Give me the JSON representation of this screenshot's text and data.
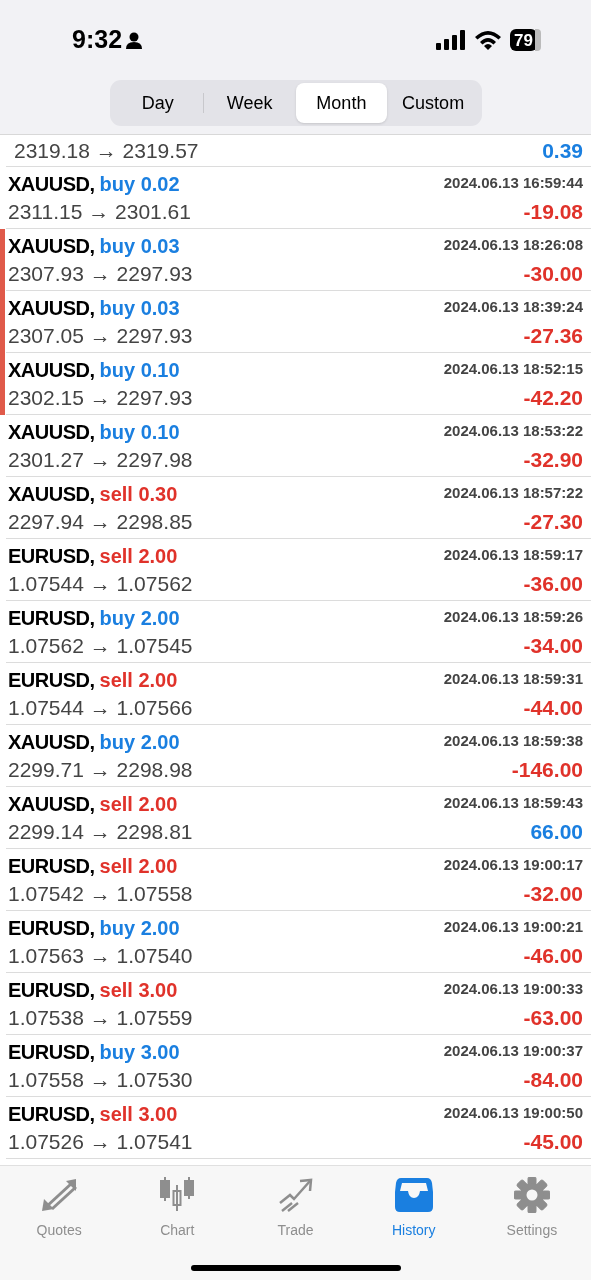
{
  "status_bar": {
    "time": "9:32",
    "battery": "79"
  },
  "segments": [
    {
      "label": "Day",
      "selected": false
    },
    {
      "label": "Week",
      "selected": false
    },
    {
      "label": "Month",
      "selected": true
    },
    {
      "label": "Custom",
      "selected": false
    }
  ],
  "partial_row": {
    "prices": "2319.18 → 2319.57",
    "profit": "0.39",
    "gain": true
  },
  "trades": [
    {
      "symbol": "XAUUSD,",
      "side": "buy",
      "volume": "0.02",
      "time": "2024.06.13 16:59:44",
      "prices": "2311.15 → 2301.61",
      "profit": "-19.08",
      "gain": false,
      "flagged": false
    },
    {
      "symbol": "XAUUSD,",
      "side": "buy",
      "volume": "0.03",
      "time": "2024.06.13 18:26:08",
      "prices": "2307.93 → 2297.93",
      "profit": "-30.00",
      "gain": false,
      "flagged": true
    },
    {
      "symbol": "XAUUSD,",
      "side": "buy",
      "volume": "0.03",
      "time": "2024.06.13 18:39:24",
      "prices": "2307.05 → 2297.93",
      "profit": "-27.36",
      "gain": false,
      "flagged": true
    },
    {
      "symbol": "XAUUSD,",
      "side": "buy",
      "volume": "0.10",
      "time": "2024.06.13 18:52:15",
      "prices": "2302.15 → 2297.93",
      "profit": "-42.20",
      "gain": false,
      "flagged": true
    },
    {
      "symbol": "XAUUSD,",
      "side": "buy",
      "volume": "0.10",
      "time": "2024.06.13 18:53:22",
      "prices": "2301.27 → 2297.98",
      "profit": "-32.90",
      "gain": false,
      "flagged": false
    },
    {
      "symbol": "XAUUSD,",
      "side": "sell",
      "volume": "0.30",
      "time": "2024.06.13 18:57:22",
      "prices": "2297.94 → 2298.85",
      "profit": "-27.30",
      "gain": false,
      "flagged": false
    },
    {
      "symbol": "EURUSD,",
      "side": "sell",
      "volume": "2.00",
      "time": "2024.06.13 18:59:17",
      "prices": "1.07544 → 1.07562",
      "profit": "-36.00",
      "gain": false,
      "flagged": false
    },
    {
      "symbol": "EURUSD,",
      "side": "buy",
      "volume": "2.00",
      "time": "2024.06.13 18:59:26",
      "prices": "1.07562 → 1.07545",
      "profit": "-34.00",
      "gain": false,
      "flagged": false
    },
    {
      "symbol": "EURUSD,",
      "side": "sell",
      "volume": "2.00",
      "time": "2024.06.13 18:59:31",
      "prices": "1.07544 → 1.07566",
      "profit": "-44.00",
      "gain": false,
      "flagged": false
    },
    {
      "symbol": "XAUUSD,",
      "side": "buy",
      "volume": "2.00",
      "time": "2024.06.13 18:59:38",
      "prices": "2299.71 → 2298.98",
      "profit": "-146.00",
      "gain": false,
      "flagged": false
    },
    {
      "symbol": "XAUUSD,",
      "side": "sell",
      "volume": "2.00",
      "time": "2024.06.13 18:59:43",
      "prices": "2299.14 → 2298.81",
      "profit": "66.00",
      "gain": true,
      "flagged": false
    },
    {
      "symbol": "EURUSD,",
      "side": "sell",
      "volume": "2.00",
      "time": "2024.06.13 19:00:17",
      "prices": "1.07542 → 1.07558",
      "profit": "-32.00",
      "gain": false,
      "flagged": false
    },
    {
      "symbol": "EURUSD,",
      "side": "buy",
      "volume": "2.00",
      "time": "2024.06.13 19:00:21",
      "prices": "1.07563 → 1.07540",
      "profit": "-46.00",
      "gain": false,
      "flagged": false
    },
    {
      "symbol": "EURUSD,",
      "side": "sell",
      "volume": "3.00",
      "time": "2024.06.13 19:00:33",
      "prices": "1.07538 → 1.07559",
      "profit": "-63.00",
      "gain": false,
      "flagged": false
    },
    {
      "symbol": "EURUSD,",
      "side": "buy",
      "volume": "3.00",
      "time": "2024.06.13 19:00:37",
      "prices": "1.07558 → 1.07530",
      "profit": "-84.00",
      "gain": false,
      "flagged": false
    },
    {
      "symbol": "EURUSD,",
      "side": "sell",
      "volume": "3.00",
      "time": "2024.06.13 19:00:50",
      "prices": "1.07526 → 1.07541",
      "profit": "-45.00",
      "gain": false,
      "flagged": false
    }
  ],
  "tab_bar": [
    {
      "label": "Quotes",
      "selected": false
    },
    {
      "label": "Chart",
      "selected": false
    },
    {
      "label": "Trade",
      "selected": false
    },
    {
      "label": "History",
      "selected": true
    },
    {
      "label": "Settings",
      "selected": false
    }
  ]
}
